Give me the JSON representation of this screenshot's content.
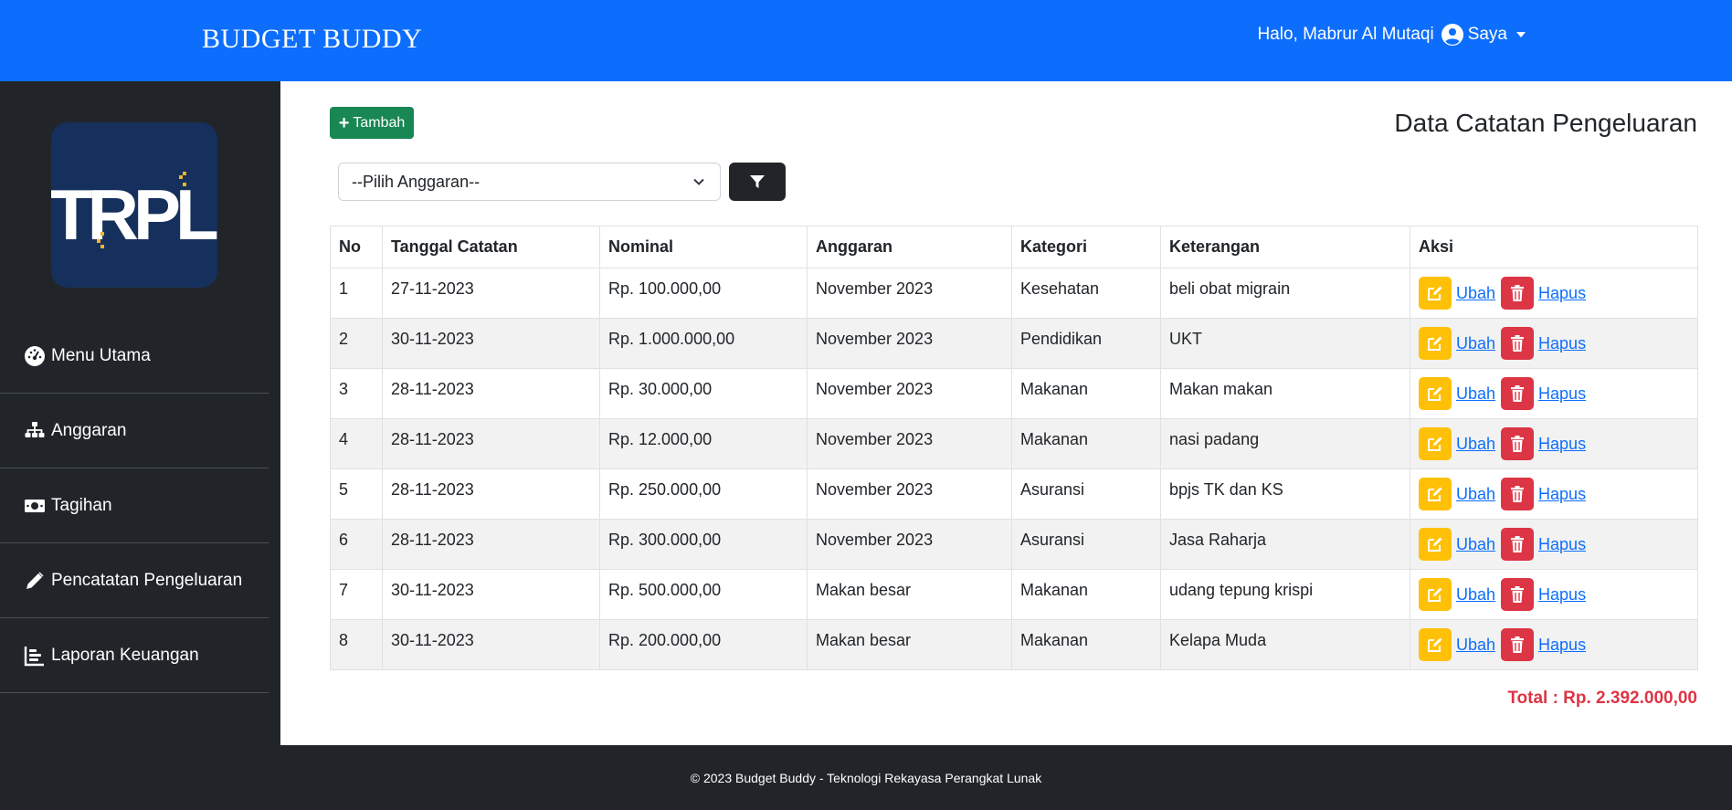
{
  "navbar": {
    "brand": "BUDGET BUDDY",
    "greeting": "Halo, Mabrur Al Mutaqi",
    "account_label": "Saya"
  },
  "sidebar": {
    "logo_text": "TRPL",
    "items": [
      {
        "label": "Menu Utama",
        "icon": "dashboard-icon"
      },
      {
        "label": "Anggaran",
        "icon": "sitemap-icon"
      },
      {
        "label": "Tagihan",
        "icon": "money-bill-icon"
      },
      {
        "label": "Pencatatan Pengeluaran",
        "icon": "pencil-icon"
      },
      {
        "label": "Laporan Keuangan",
        "icon": "chart-icon"
      }
    ]
  },
  "main": {
    "add_button": "Tambah",
    "title": "Data Catatan Pengeluaran",
    "select_value": "--Pilih Anggaran--",
    "table": {
      "headers": [
        "No",
        "Tanggal Catatan",
        "Nominal",
        "Anggaran",
        "Kategori",
        "Keterangan",
        "Aksi"
      ],
      "edit_label": "Ubah",
      "delete_label": "Hapus",
      "rows": [
        [
          "1",
          "27-11-2023",
          "Rp. 100.000,00",
          "November 2023",
          "Kesehatan",
          "beli obat migrain"
        ],
        [
          "2",
          "30-11-2023",
          "Rp. 1.000.000,00",
          "November 2023",
          "Pendidikan",
          "UKT"
        ],
        [
          "3",
          "28-11-2023",
          "Rp. 30.000,00",
          "November 2023",
          "Makanan",
          "Makan makan"
        ],
        [
          "4",
          "28-11-2023",
          "Rp. 12.000,00",
          "November 2023",
          "Makanan",
          "nasi padang"
        ],
        [
          "5",
          "28-11-2023",
          "Rp. 250.000,00",
          "November 2023",
          "Asuransi",
          "bpjs TK dan KS"
        ],
        [
          "6",
          "28-11-2023",
          "Rp. 300.000,00",
          "November 2023",
          "Asuransi",
          "Jasa Raharja"
        ],
        [
          "7",
          "30-11-2023",
          "Rp. 500.000,00",
          "Makan besar",
          "Makanan",
          "udang tepung krispi"
        ],
        [
          "8",
          "30-11-2023",
          "Rp. 200.000,00",
          "Makan besar",
          "Makanan",
          "Kelapa Muda"
        ]
      ]
    },
    "total": "Total : Rp. 2.392.000,00"
  },
  "footer": {
    "text": "© 2023 Budget Buddy - Teknologi Rekayasa Perangkat Lunak"
  },
  "colors": {
    "navbar": "#0d6efd",
    "sidebar": "#212529",
    "add_button": "#198754",
    "edit_button": "#ffc107",
    "delete_button": "#dc3545",
    "total": "#dc3545"
  }
}
